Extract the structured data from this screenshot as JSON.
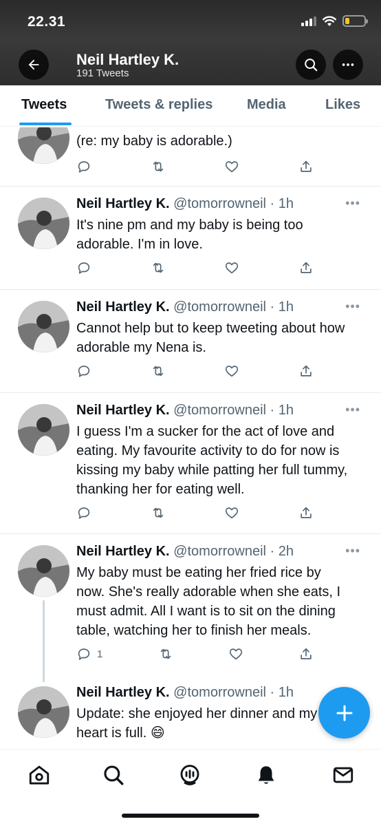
{
  "status_bar": {
    "time": "22.31"
  },
  "header": {
    "title": "Neil Hartley K.",
    "tweet_count": "191 Tweets"
  },
  "tabs": [
    {
      "label": "Tweets",
      "active": true
    },
    {
      "label": "Tweets & replies",
      "active": false
    },
    {
      "label": "Media",
      "active": false
    },
    {
      "label": "Likes",
      "active": false
    }
  ],
  "colors": {
    "accent": "#1d9bf0",
    "text": "#0f1419",
    "muted": "#536471",
    "header_bg": "#2e2e2e"
  },
  "tweets": [
    {
      "name": "",
      "handle": "",
      "time": "",
      "text": "(re: my baby is adorable.)",
      "reply_count": ""
    },
    {
      "name": "Neil Hartley K.",
      "handle": "@tomorrowneil",
      "time": "· 1h",
      "text": "It's nine pm and my baby is being too adorable. I'm in love.",
      "reply_count": ""
    },
    {
      "name": "Neil Hartley K.",
      "handle": "@tomorrowneil",
      "time": "· 1h",
      "text": "Cannot help but to keep tweeting about how adorable my Nena is.",
      "reply_count": ""
    },
    {
      "name": "Neil Hartley K.",
      "handle": "@tomorrowneil",
      "time": "· 1h",
      "text": "I guess I'm a sucker for the act of love and eating. My favourite activity to do for now is kissing my baby while patting her full tummy, thanking her for eating well.",
      "reply_count": ""
    },
    {
      "name": "Neil Hartley K.",
      "handle": "@tomorrowneil",
      "time": "· 2h",
      "text": "My baby must be eating her fried rice by now. She's really adorable when she eats, I must admit. All I want is to sit on the dining table, watching her to finish her meals.",
      "reply_count": "1"
    },
    {
      "name": "Neil Hartley K.",
      "handle": "@tomorrowneil",
      "time": "· 1h",
      "text": "Update: she enjoyed her dinner and my heart is full. 😄",
      "reply_count": ""
    }
  ],
  "icons": {
    "reply": "reply-icon",
    "retweet": "retweet-icon",
    "like": "heart-icon",
    "share": "share-icon",
    "more": "more-icon",
    "fab": "compose-icon"
  },
  "bottom_nav": [
    "home-icon",
    "search-icon",
    "spaces-icon",
    "notifications-icon",
    "messages-icon"
  ]
}
